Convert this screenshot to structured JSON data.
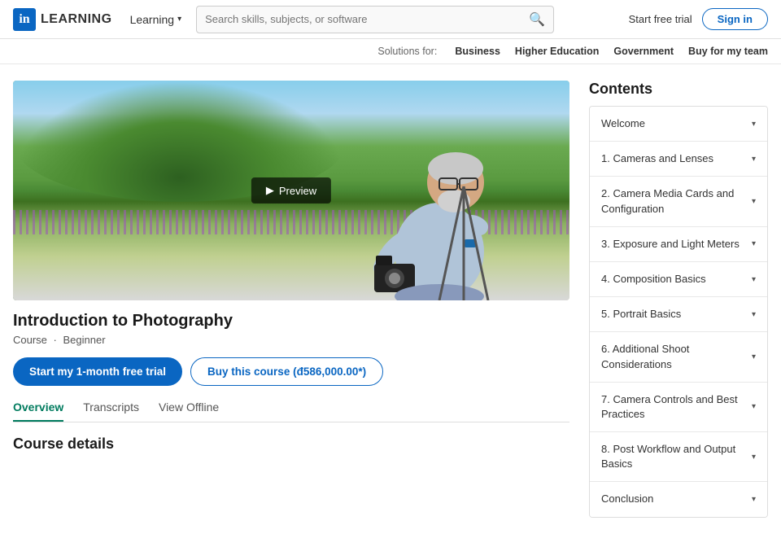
{
  "header": {
    "logo_letter": "in",
    "logo_label": "LEARNING",
    "dropdown_label": "Learning",
    "search_placeholder": "Search skills, subjects, or software",
    "start_free_trial": "Start free trial",
    "sign_in": "Sign in"
  },
  "subnav": {
    "solutions_label": "Solutions for:",
    "links": [
      "Business",
      "Higher Education",
      "Government",
      "Buy for my team"
    ]
  },
  "course": {
    "title": "Introduction to Photography",
    "type": "Course",
    "level": "Beginner",
    "preview_label": "Preview",
    "btn_primary": "Start my 1-month free trial",
    "btn_outline": "Buy this course (đ586,000.00*)",
    "tabs": [
      "Overview",
      "Transcripts",
      "View Offline"
    ],
    "active_tab": "Overview",
    "details_heading": "Course details"
  },
  "contents": {
    "heading": "Contents",
    "items": [
      {
        "label": "Welcome"
      },
      {
        "label": "1. Cameras and Lenses"
      },
      {
        "label": "2. Camera Media Cards and Configuration"
      },
      {
        "label": "3. Exposure and Light Meters"
      },
      {
        "label": "4. Composition Basics"
      },
      {
        "label": "5. Portrait Basics"
      },
      {
        "label": "6. Additional Shoot Considerations"
      },
      {
        "label": "7. Camera Controls and Best Practices"
      },
      {
        "label": "8. Post Workflow and Output Basics"
      },
      {
        "label": "Conclusion"
      }
    ]
  }
}
